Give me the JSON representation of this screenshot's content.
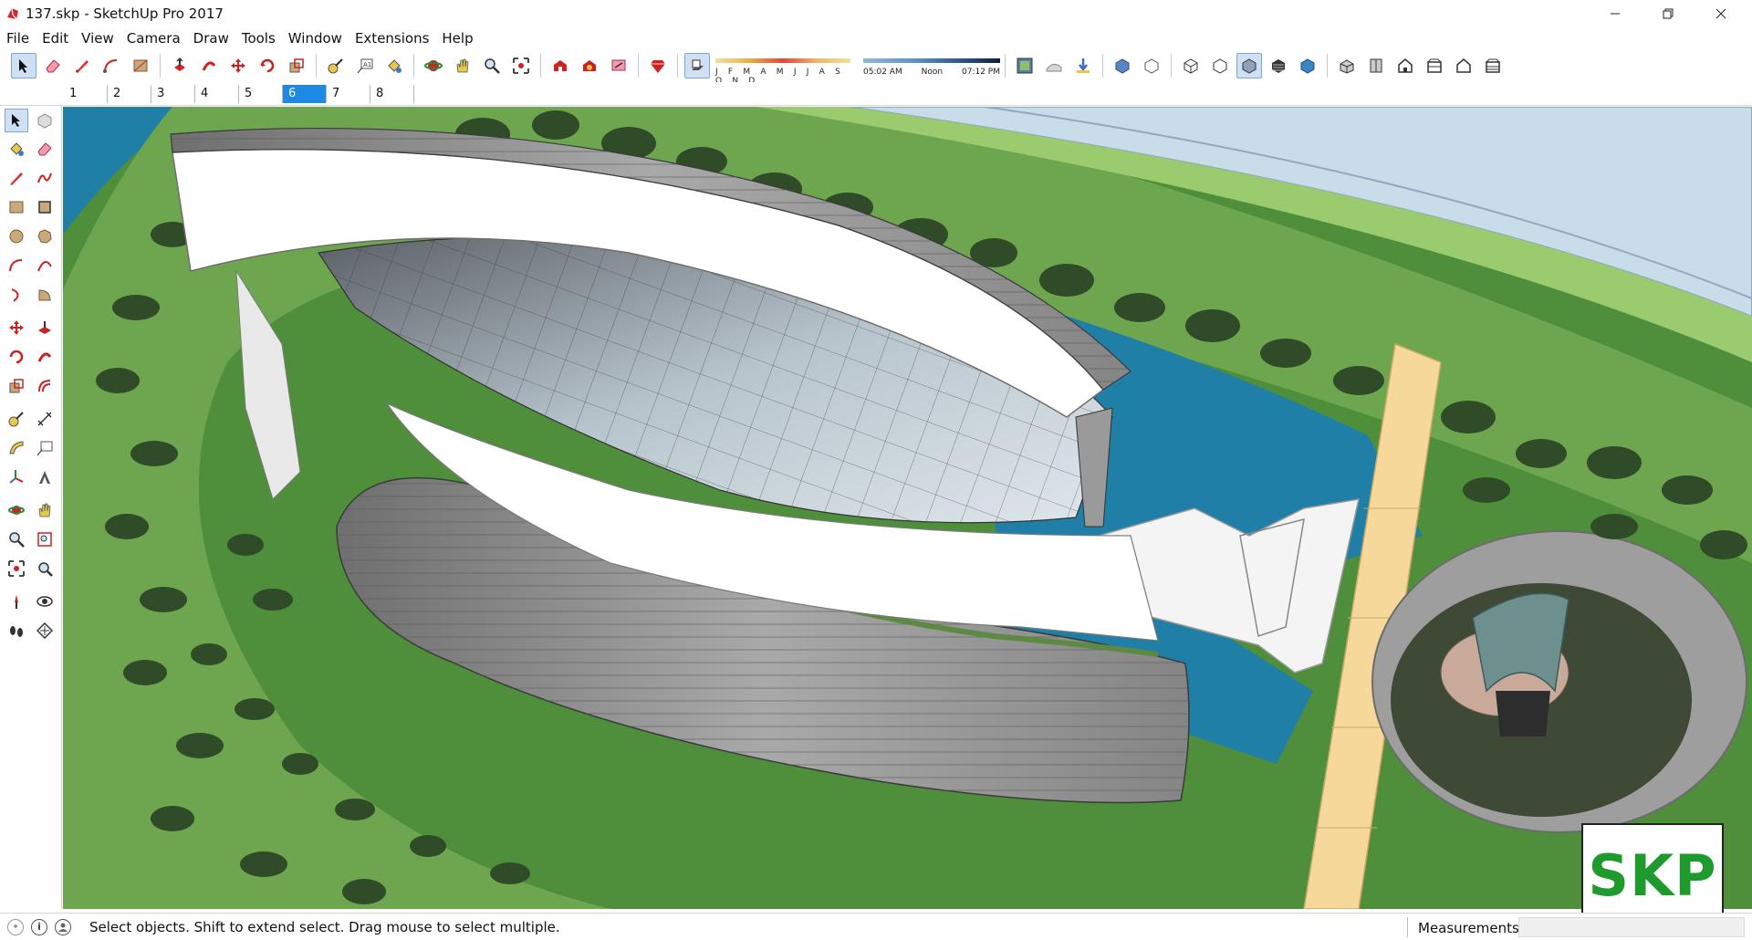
{
  "window": {
    "title": "137.skp - SketchUp Pro 2017",
    "controls": [
      "minimize",
      "restore",
      "close"
    ]
  },
  "menu": {
    "items": [
      "File",
      "Edit",
      "View",
      "Camera",
      "Draw",
      "Tools",
      "Window",
      "Extensions",
      "Help"
    ]
  },
  "toolbar": {
    "months": "J F M A M J J A S O N D",
    "time_start": "05:02 AM",
    "time_mid": "Noon",
    "time_end": "07:12 PM"
  },
  "scenes": {
    "tabs": [
      "1",
      "2",
      "3",
      "4",
      "5",
      "6",
      "7",
      "8"
    ],
    "active": "6"
  },
  "status": {
    "message": "Select objects. Shift to extend select. Drag mouse to select multiple.",
    "measurements_label": "Measurements",
    "measurements_value": ""
  },
  "watermark": {
    "text": "SKP"
  },
  "colors": {
    "grass": "#4f8f3b",
    "water": "#1f7fa6",
    "path": "#f6d99a",
    "road": "#c9dcea",
    "tree": "#2f4b28",
    "active_tab": "#1e88e5",
    "logo_green": "#1f9a2c"
  },
  "icons": {
    "app": "sketchup-icon",
    "minimize": "minimize-icon",
    "restore": "restore-icon",
    "close": "close-icon"
  }
}
